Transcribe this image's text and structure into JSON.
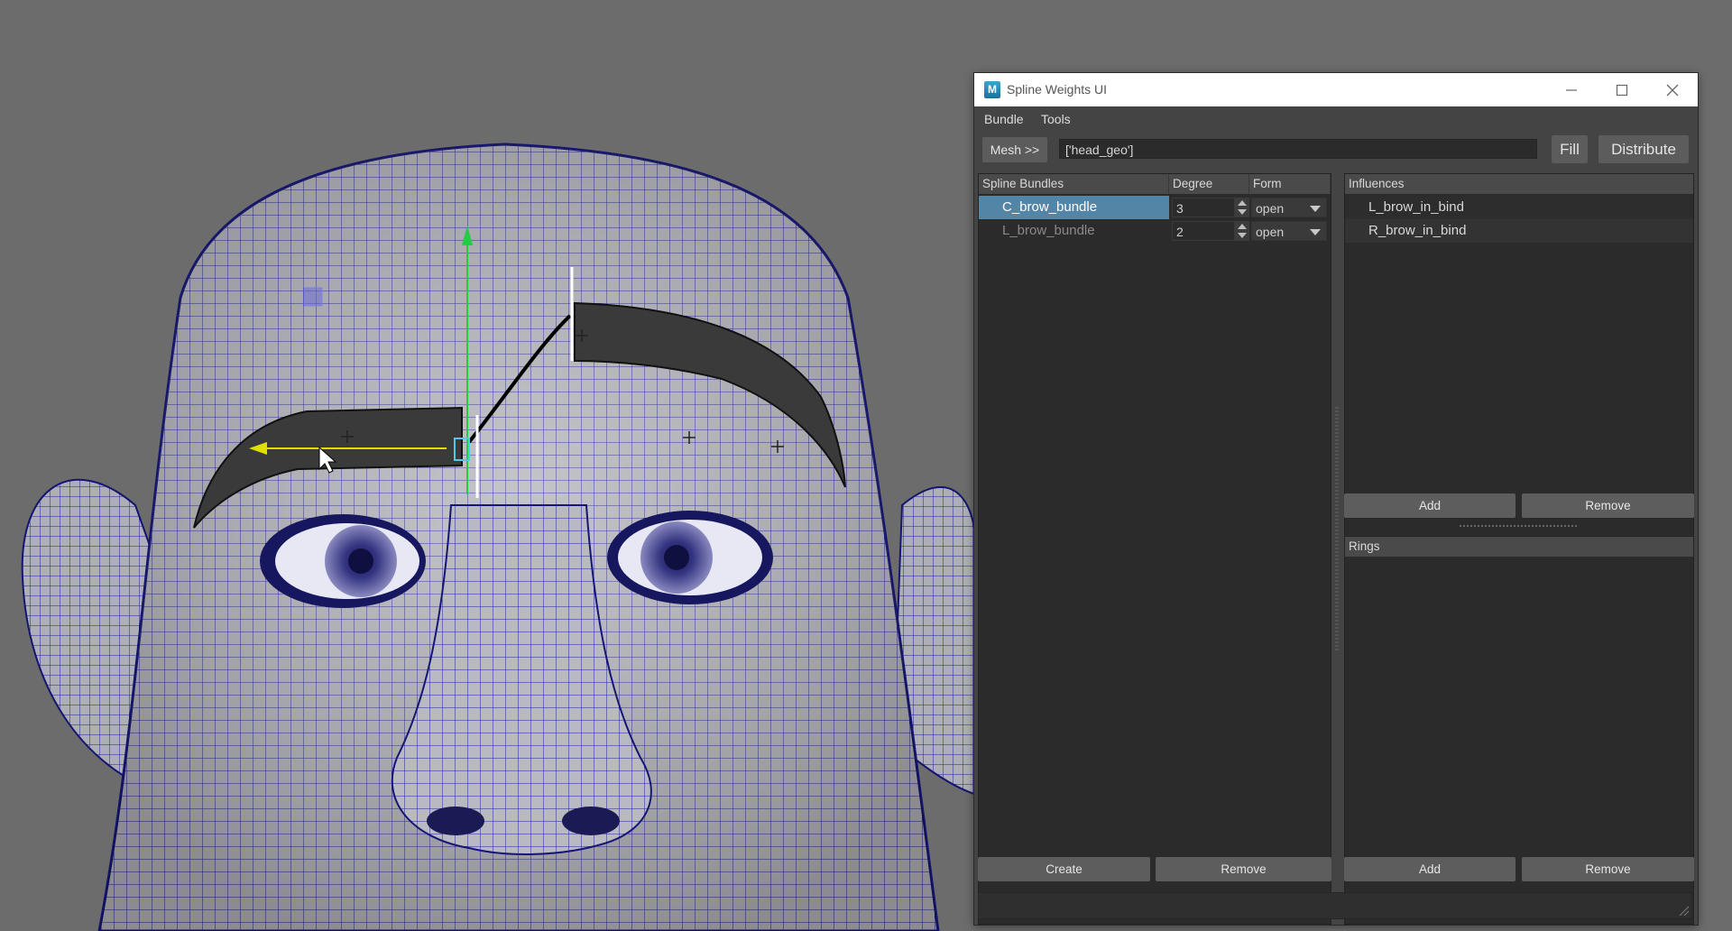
{
  "window": {
    "title": "Spline Weights UI",
    "app_icon_letter": "M"
  },
  "menu": [
    "Bundle",
    "Tools"
  ],
  "toolbar": {
    "mesh_button": "Mesh >>",
    "mesh_value": "['head_geo']",
    "fill_button": "Fill",
    "distribute_button": "Distribute"
  },
  "bundles": {
    "headers": [
      "Spline Bundles",
      "Degree",
      "Form"
    ],
    "rows": [
      {
        "name": "C_brow_bundle",
        "degree": "3",
        "form": "open",
        "selected": true
      },
      {
        "name": "L_brow_bundle",
        "degree": "2",
        "form": "open",
        "selected": false
      }
    ],
    "create_button": "Create",
    "remove_button": "Remove"
  },
  "influences": {
    "header": "Influences",
    "items": [
      "L_brow_in_bind",
      "R_brow_in_bind"
    ],
    "add_button": "Add",
    "remove_button": "Remove"
  },
  "rings": {
    "header": "Rings",
    "add_button": "Add",
    "remove_button": "Remove"
  },
  "colors": {
    "viewport_bg": "#6c6c6c",
    "wireframe": "#1a1a8c",
    "selection": "#5285a6",
    "translate_y_axis": "#22cc44",
    "translate_x_axis": "#e0e000"
  }
}
